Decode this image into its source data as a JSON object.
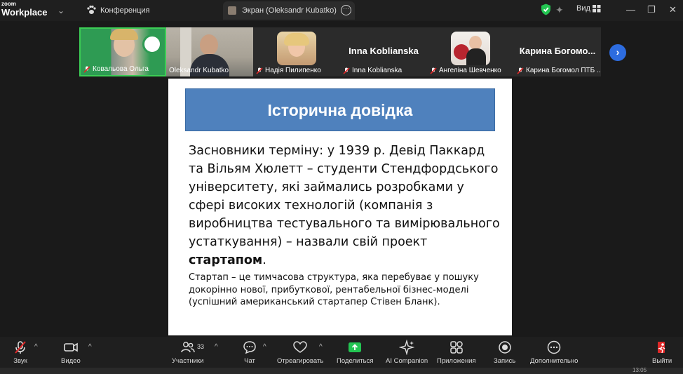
{
  "titlebar": {
    "brand_top": "zoom",
    "brand_bottom": "Workplace",
    "conference_label": "Конференция",
    "screen_tab_label": "Экран (Oleksandr Kubatko)",
    "view_label": "Вид"
  },
  "participants": [
    {
      "name": "Ковальова Ольга",
      "muted": true
    },
    {
      "name": "Oleksandr Kubatko",
      "muted": false
    },
    {
      "name": "Надія Пилипенко",
      "muted": true
    },
    {
      "name": "Inna Koblianska",
      "muted": true,
      "display_name": "Inna Koblianska"
    },
    {
      "name": "Ангеліна Шевченко",
      "muted": true
    },
    {
      "name": "Карина Богомол ПТБ ...",
      "muted": true,
      "display_name": "Карина  Богомо..."
    }
  ],
  "slide": {
    "title": "Історична довідка",
    "body_main": "Засновники терміну: у 1939 р. Девід Паккард та Вільям Хюлетт – студенти Стендфордського університету, які займались розробками у сфері високих технологій (компанія з виробництва тестувального та вимірювального устаткування) – назвали свій проект ",
    "body_bold": "стартапом",
    "body_end": ".",
    "note": "Стартап – це тимчасова структура, яка перебуває у пошуку докорінно нової, прибуткової, рентабельної бізнес-моделі (успішний американський стартапер Стівен Бланк)."
  },
  "toolbar": {
    "audio": "Звук",
    "video": "Видео",
    "participants": "Участники",
    "participants_count": "33",
    "chat": "Чат",
    "react": "Отреагировать",
    "share": "Поделиться",
    "ai": "AI Companion",
    "apps": "Приложения",
    "record": "Запись",
    "more": "Дополнительно",
    "leave": "Выйти"
  },
  "clock": "13:05",
  "colors": {
    "active_border": "#3ccd55",
    "slide_title_bg": "#4f81bd",
    "share_green": "#23c552",
    "leave_red": "#e02828",
    "next_blue": "#2d6cdf"
  }
}
